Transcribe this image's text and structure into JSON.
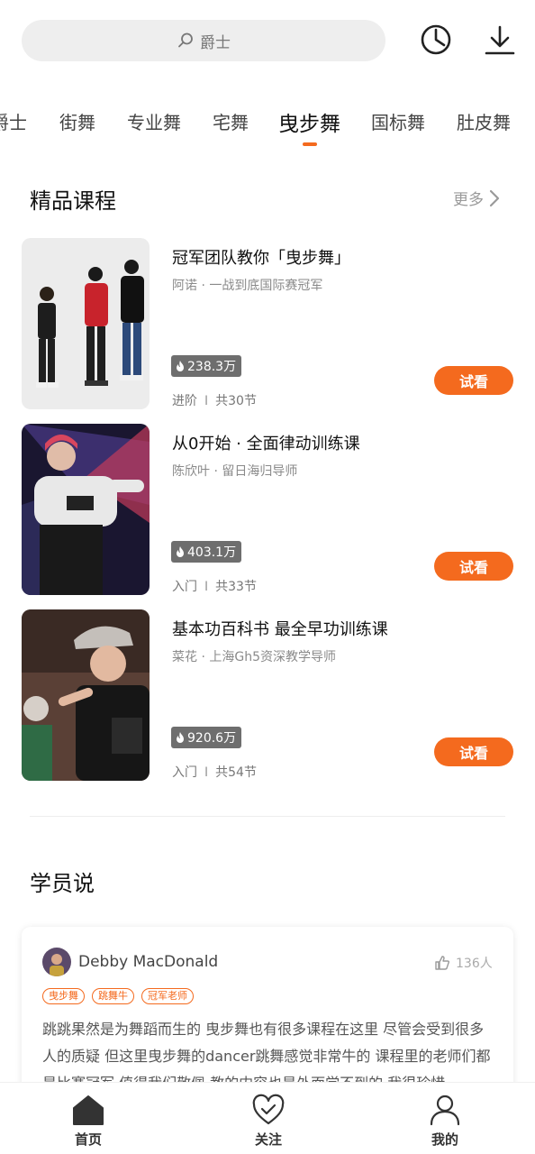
{
  "search": {
    "query": "爵士"
  },
  "tabs": [
    {
      "label": "爵士"
    },
    {
      "label": "街舞"
    },
    {
      "label": "专业舞"
    },
    {
      "label": "宅舞"
    },
    {
      "label": "曳步舞",
      "active": true
    },
    {
      "label": "国标舞"
    },
    {
      "label": "肚皮舞"
    }
  ],
  "premium": {
    "title": "精品课程",
    "more_label": "更多",
    "courses": [
      {
        "title": "冠军团队教你「曳步舞」",
        "teacher": "阿诺 · 一战到底国际赛冠军",
        "heat": "238.3万",
        "level": "进阶",
        "lessons": "共30节",
        "preview_label": "试看"
      },
      {
        "title": "从0开始 · 全面律动训练课",
        "teacher": "陈欣叶 · 留日海归导师",
        "heat": "403.1万",
        "level": "入门",
        "lessons": "共33节",
        "preview_label": "试看"
      },
      {
        "title": "基本功百科书 最全早功训练课",
        "teacher": "菜花 · 上海Gh5资深教学导师",
        "heat": "920.6万",
        "level": "入门",
        "lessons": "共54节",
        "preview_label": "试看"
      }
    ]
  },
  "students": {
    "title": "学员说",
    "review": {
      "name": "Debby MacDonald",
      "likes": "136人",
      "tags": [
        "曳步舞",
        "跳舞牛",
        "冠军老师"
      ],
      "text": "跳跳果然是为舞蹈而生的 曳步舞也有很多课程在这里 尽管会受到很多人的质疑 但这里曳步舞的dancer跳舞感觉非常牛的 课程里的老师们都是比赛冠军 值得我们敬佩 教的内容也是外面学不到的 我很珍惜"
    }
  },
  "bottom_nav": [
    {
      "label": "首页",
      "active": true
    },
    {
      "label": "关注"
    },
    {
      "label": "我的"
    }
  ],
  "colors": {
    "accent": "#f46a1e",
    "heat_badge": "#6e6e6e",
    "search_bg": "#eeeeee"
  }
}
